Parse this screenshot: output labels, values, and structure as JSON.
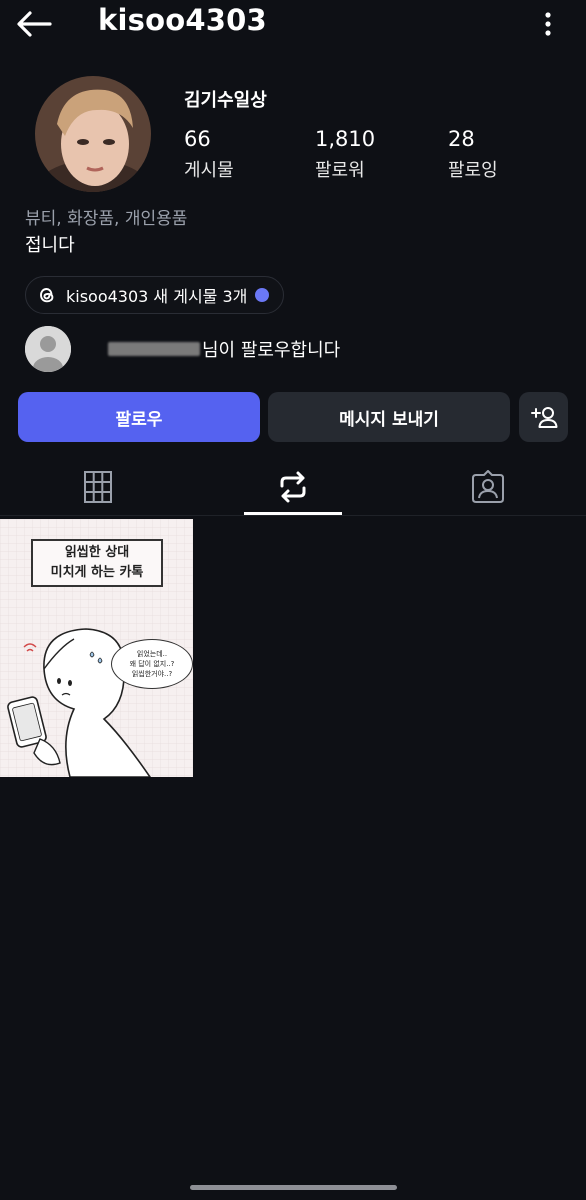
{
  "header": {
    "username": "kisoo4303",
    "back_icon": "arrow-left-icon",
    "more_icon": "more-vertical-icon"
  },
  "profile": {
    "display_name": "김기수일상",
    "stats": [
      {
        "value": "66",
        "label": "게시물"
      },
      {
        "value": "1,810",
        "label": "팔로워"
      },
      {
        "value": "28",
        "label": "팔로잉"
      }
    ],
    "category": "뷰티, 화장품, 개인용품",
    "bio": "접니다"
  },
  "threads": {
    "text": "kisoo4303 새 게시물 3개",
    "icon": "threads-icon",
    "dot_color": "#6b78f5"
  },
  "mutual": {
    "suffix": "님이 팔로우합니다"
  },
  "actions": {
    "follow_label": "팔로우",
    "message_label": "메시지 보내기",
    "add_user_icon": "add-user-icon",
    "follow_color": "#5562f0"
  },
  "tabs": [
    {
      "icon": "grid-icon",
      "selected": false
    },
    {
      "icon": "repost-icon",
      "selected": true
    },
    {
      "icon": "tagged-icon",
      "selected": false
    }
  ],
  "posts": [
    {
      "title_lines": [
        "읽씹한 상대",
        "미치게 하는 카톡"
      ],
      "bubble_lines": [
        "읽었는데..",
        "왜 답이 없지..?",
        "읽씹한거야..?"
      ]
    }
  ]
}
